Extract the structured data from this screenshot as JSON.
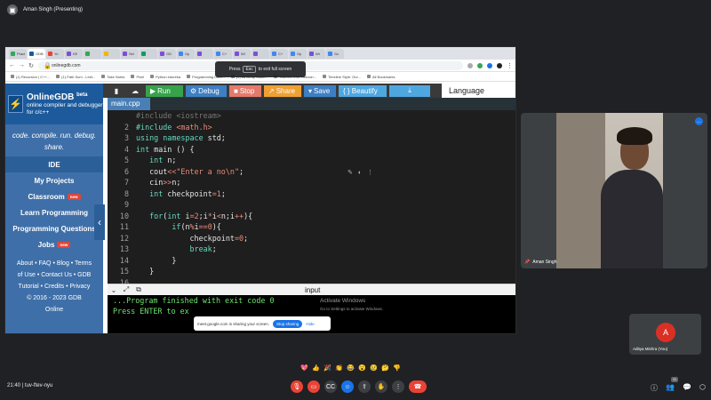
{
  "meet": {
    "presenting_label": "Aman Singh (Presenting)",
    "time": "21:40",
    "meeting_code": "tuv-ftev-nyu",
    "main_participant": "Aman Singh",
    "second_participant": "Aditya Mishra (You)",
    "second_avatar_initial": "A",
    "people_count": "11",
    "more_icon": "…"
  },
  "browser": {
    "url": "onlinegdb.com",
    "tabs": [
      {
        "label": "Pract",
        "color": "#34a853"
      },
      {
        "label": "GDB",
        "color": "#1d5a9c"
      },
      {
        "label": "Yo",
        "color": "#ea4335"
      },
      {
        "label": "KE",
        "color": "#7b4fd6"
      },
      {
        "label": "",
        "color": "#34a853"
      },
      {
        "label": "",
        "color": "#f4b400"
      },
      {
        "label": "Sel",
        "color": "#7b4fd6"
      },
      {
        "label": "",
        "color": "#0f9d58"
      },
      {
        "label": "GD",
        "color": "#7b4fd6"
      },
      {
        "label": "Op",
        "color": "#4285f4"
      },
      {
        "label": "",
        "color": "#7b4fd6"
      },
      {
        "label": "C+",
        "color": "#4285f4"
      },
      {
        "label": "Wl",
        "color": "#7b4fd6"
      },
      {
        "label": "",
        "color": "#7b4fd6"
      },
      {
        "label": "C+",
        "color": "#4285f4"
      },
      {
        "label": "Op",
        "color": "#4285f4"
      },
      {
        "label": "Wr",
        "color": "#7b4fd6"
      },
      {
        "label": "Go",
        "color": "#4285f4"
      }
    ],
    "bookmarks": [
      "(1) Recursion | C++...",
      "(1) Path Sum - Leet...",
      "Take Notes",
      "Pixel",
      "Python edureka",
      "Programming Licol...",
      "(1) BinStrap Basic...",
      "Tailored CSE Horizon...",
      "Timeline Style: Our...",
      "All Bookmarks"
    ],
    "fullscreen_hint_pre": "Press",
    "fullscreen_hint_key": "Esc",
    "fullscreen_hint_post": "to exit full screen"
  },
  "gdb": {
    "brand": "OnlineGDB",
    "beta": "beta",
    "brand_sub": "online compiler and debugger for c/c++",
    "tagline": "code. compile. run. debug. share.",
    "menu": [
      {
        "label": "IDE",
        "badge": ""
      },
      {
        "label": "My Projects",
        "badge": ""
      },
      {
        "label": "Classroom",
        "badge": "new"
      },
      {
        "label": "Learn Programming",
        "badge": ""
      },
      {
        "label": "Programming Questions",
        "badge": ""
      },
      {
        "label": "Jobs",
        "badge": "new"
      }
    ],
    "footer": {
      "line1": "About • FAQ • Blog • Terms",
      "line2": "of Use • Contact Us • GDB",
      "line3": "Tutorial • Credits • Privacy",
      "line4": "© 2016 - 2023 GDB",
      "line5": "Online"
    },
    "toolbar": {
      "run": "Run",
      "debug": "Debug",
      "stop": "Stop",
      "share": "Share",
      "save": "Save",
      "beautify": "{ } Beautify",
      "language": "Language"
    },
    "file_tab": "main.cpp",
    "input_label": "input",
    "console": [
      "...Program finished with exit code 0",
      "Press ENTER to ex"
    ],
    "activate_title": "Activate Windows",
    "activate_sub": "Go to Settings to activate Windows."
  },
  "share_banner": {
    "message": "meet.google.com is sharing your screen.",
    "stop": "Stop sharing",
    "hide": "Hide"
  },
  "reactions": [
    "💖",
    "👍",
    "🎉",
    "👏",
    "😂",
    "😮",
    "😢",
    "🤔",
    "👎"
  ]
}
